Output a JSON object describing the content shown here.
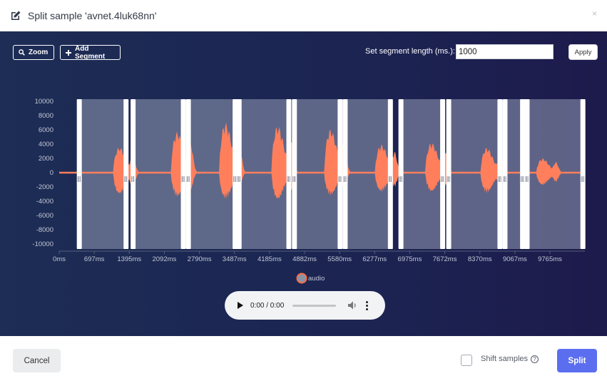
{
  "dialog": {
    "title": "Split sample 'avnet.4luk68nn'",
    "close_glyph": "×"
  },
  "toolbar": {
    "zoom_label": "Zoom",
    "add_segment_label": "Add Segment",
    "segment_length_label": "Set segment length (ms.):",
    "segment_length_value": "1000",
    "apply_label": "Apply"
  },
  "chart_data": {
    "type": "line",
    "series": [
      {
        "name": "audio",
        "color": "#ff7f5c"
      }
    ],
    "x_ticks": [
      "0ms",
      "697ms",
      "1395ms",
      "2092ms",
      "2790ms",
      "3487ms",
      "4185ms",
      "4882ms",
      "5580ms",
      "6277ms",
      "6975ms",
      "7672ms",
      "8370ms",
      "9067ms",
      "9765ms"
    ],
    "y_ticks": [
      "10000",
      "8000",
      "6000",
      "4000",
      "2000",
      "0",
      "-2000",
      "-4000",
      "-6000",
      "-8000",
      "-10000"
    ],
    "ylim": [
      -10000,
      10000
    ],
    "xlim_ms": [
      0,
      10460
    ],
    "segments_ms": [
      [
        400,
        1330
      ],
      [
        1470,
        2470
      ],
      [
        2570,
        3500
      ],
      [
        3580,
        4570
      ],
      [
        4680,
        5590
      ],
      [
        5690,
        6590
      ],
      [
        6800,
        7630
      ],
      [
        7750,
        8770
      ],
      [
        8870,
        9220
      ],
      [
        9310,
        10420
      ]
    ],
    "bursts": [
      {
        "start_ms": 1070,
        "peak": 5000,
        "trough": -4300
      },
      {
        "start_ms": 2220,
        "peak": 8000,
        "trough": -4800
      },
      {
        "start_ms": 3180,
        "peak": 9800,
        "trough": -5200
      },
      {
        "start_ms": 4220,
        "peak": 9200,
        "trough": -5400
      },
      {
        "start_ms": 5270,
        "peak": 8500,
        "trough": -4500
      },
      {
        "start_ms": 6280,
        "peak": 5500,
        "trough": -3800
      },
      {
        "start_ms": 7280,
        "peak": 5900,
        "trough": -3800
      },
      {
        "start_ms": 8380,
        "peak": 4900,
        "trough": -4000
      },
      {
        "start_ms": 9490,
        "peak": 2800,
        "trough": -2500
      }
    ]
  },
  "legend": {
    "label": "audio"
  },
  "audio_player": {
    "time": "0:00 / 0:00"
  },
  "footer": {
    "cancel_label": "Cancel",
    "shift_label": "Shift samples",
    "split_label": "Split"
  }
}
